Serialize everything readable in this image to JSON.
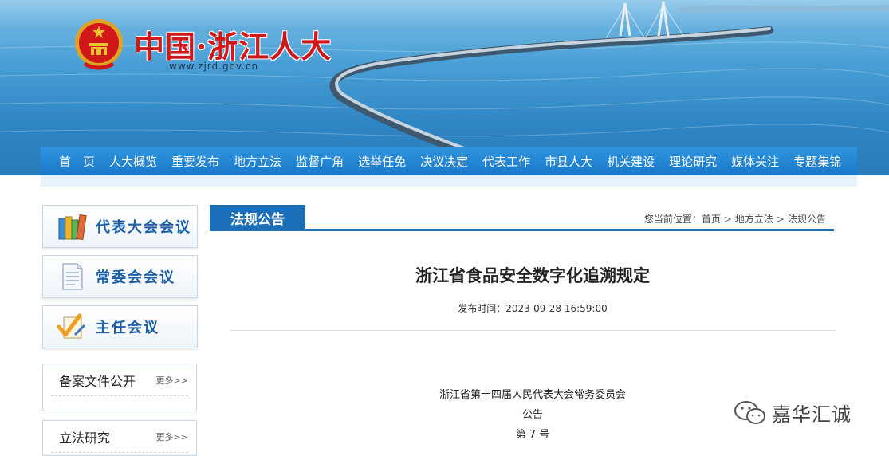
{
  "header": {
    "site_title": "中国·浙江人大",
    "site_url": "www.zjrd.gov.cn"
  },
  "nav": {
    "items": [
      "首　页",
      "人大概览",
      "重要发布",
      "地方立法",
      "监督广角",
      "选举任免",
      "决议决定",
      "代表工作",
      "市县人大",
      "机关建设",
      "理论研究",
      "媒体关注",
      "专题集锦"
    ]
  },
  "sidebar": {
    "buttons": [
      {
        "label": "代表大会会议",
        "icon": "books-icon"
      },
      {
        "label": "常委会会议",
        "icon": "document-icon"
      },
      {
        "label": "主任会议",
        "icon": "check-pen-icon"
      }
    ],
    "boxes": [
      {
        "title": "备案文件公开",
        "more": "更多>>"
      },
      {
        "title": "立法研究",
        "more": "更多>>"
      }
    ]
  },
  "section": {
    "tab": "法规公告",
    "breadcrumb_prefix": "您当前位置：",
    "breadcrumb": [
      "首页",
      "地方立法",
      "法规公告"
    ],
    "breadcrumb_sep": ">"
  },
  "article": {
    "title": "浙江省食品安全数字化追溯规定",
    "publish_time": "发布时间：2023-09-28 16:59:00",
    "lines": [
      "浙江省第十四届人民代表大会常务委员会",
      "公告",
      "第 7 号"
    ]
  },
  "watermark": {
    "text": "嘉华汇诚",
    "icon": "wechat-icon"
  },
  "colors": {
    "brand_red": "#d0171a",
    "nav_blue": "#1a78c8",
    "section_blue": "#1a6fb8"
  }
}
